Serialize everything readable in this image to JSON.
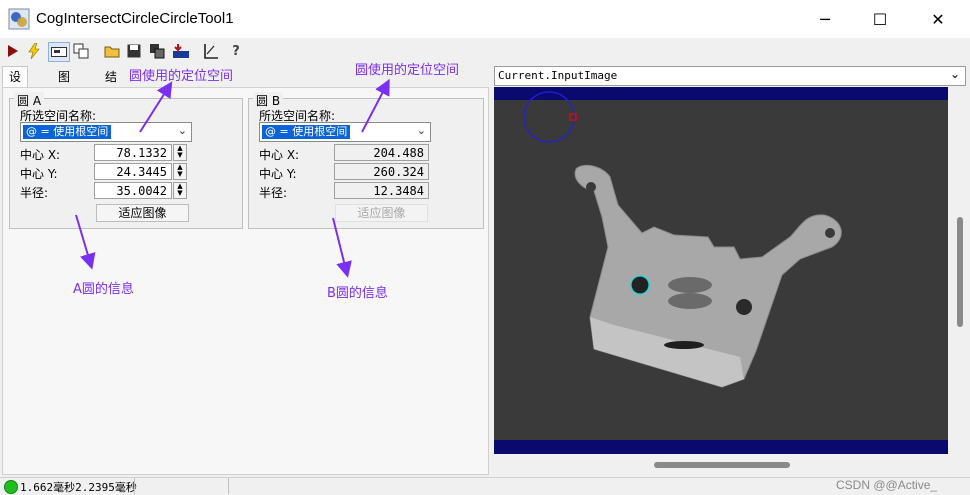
{
  "window": {
    "title": "CogIntersectCircleCircleTool1",
    "minimize": "─",
    "maximize": "☐",
    "close": "✕"
  },
  "toolbar": {
    "icons": [
      "run-icon",
      "electric-run-icon",
      "display-icon",
      "reset-icon",
      "open-icon",
      "save-icon",
      "copy-icon",
      "import-icon",
      "ruler-icon",
      "help-icon"
    ]
  },
  "tabs": [
    "设置",
    "图形",
    "结果"
  ],
  "circle_a": {
    "legend": "圆 A",
    "space_label": "所选空间名称:",
    "space_value": "@ = 使用根空间",
    "center_x_label": "中心 X:",
    "center_x": "78.1332",
    "center_y_label": "中心 Y:",
    "center_y": "24.3445",
    "radius_label": "半径:",
    "radius": "35.0042",
    "fit_button": "适应图像"
  },
  "circle_b": {
    "legend": "圆 B",
    "space_label": "所选空间名称:",
    "space_value": "@ = 使用根空间",
    "center_x_label": "中心 X:",
    "center_x": "204.488",
    "center_y_label": "中心 Y:",
    "center_y": "260.324",
    "radius_label": "半径:",
    "radius": "12.3484",
    "fit_button": "适应图像"
  },
  "annotations": {
    "space_a": "圆使用的定位空间",
    "space_b": "圆使用的定位空间",
    "info_a": "A圆的信息",
    "info_b": "B圆的信息"
  },
  "image_source": "Current.InputImage",
  "status": {
    "text": "1.662毫秒2.2395毫秒",
    "ok_color": "#1fbf1f"
  },
  "watermark": "CSDN @@Active_",
  "colors": {
    "annotation": "#7b2ff0",
    "viewer_band": "#0a0a6e",
    "circle_a_graphic": "#2020e0",
    "circle_b_graphic": "#00e0e0"
  }
}
